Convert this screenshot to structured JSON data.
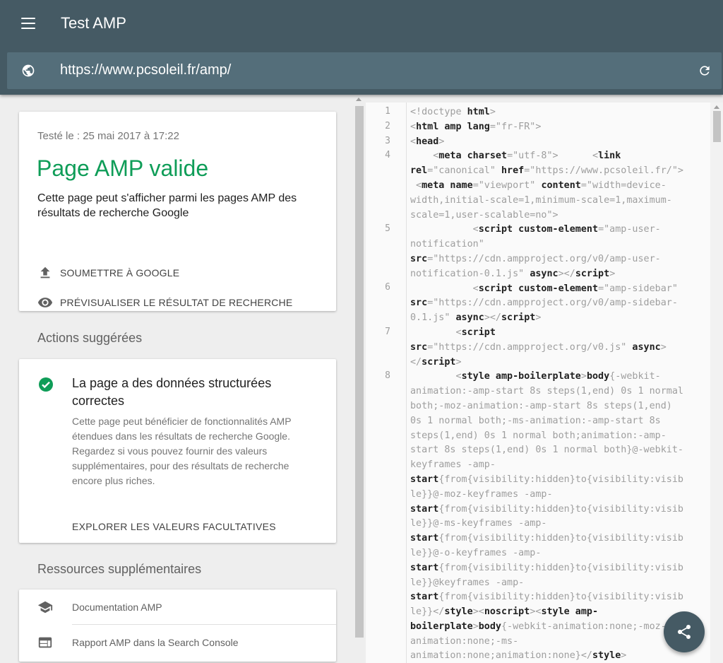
{
  "appbar": {
    "title": "Test AMP"
  },
  "urlbar": {
    "url": "https://www.pcsoleil.fr/amp/"
  },
  "status_card": {
    "tested_on": "Testé le : 25 mai 2017 à 17:22",
    "title": "Page AMP valide",
    "description": "Cette page peut s'afficher parmi les pages AMP des résultats de recherche Google",
    "submit_label": "SOUMETTRE À GOOGLE",
    "preview_label": "PRÉVISUALISER LE RÉSULTAT DE RECHERCHE"
  },
  "suggested": {
    "section_title": "Actions suggérées",
    "card_title": "La page a des données structurées correctes",
    "card_description": "Cette page peut bénéficier de fonctionnalités AMP étendues dans les résultats de recherche Google. Regardez si vous pouvez fournir des valeurs supplémentaires, pour des résultats de recherche encore plus riches.",
    "link_label": "EXPLORER LES VALEURS FACULTATIVES"
  },
  "resources": {
    "section_title": "Ressources supplémentaires",
    "items": [
      {
        "label": "Documentation AMP",
        "icon": "school-icon"
      },
      {
        "label": "Rapport AMP dans la Search Console",
        "icon": "web-icon"
      }
    ]
  },
  "code": {
    "line_numbers": [
      "1",
      "2",
      "3",
      "4",
      "5",
      "6",
      "7",
      "8"
    ]
  },
  "colors": {
    "appbar": "#455a64",
    "urlbar": "#546e7a",
    "valid_green": "#0f9d58"
  }
}
